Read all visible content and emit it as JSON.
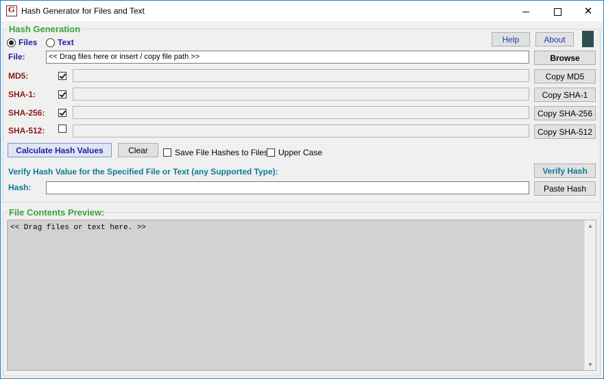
{
  "window": {
    "title": "Hash Generator for Files and Text",
    "app_icon_glyph": "G",
    "minimize": "minimize",
    "maximize": "maximize",
    "close": "✕"
  },
  "hash_generation": {
    "group_title": "Hash Generation",
    "mode": {
      "files_label": "Files",
      "text_label": "Text",
      "selected": "Files"
    },
    "help_label": "Help",
    "about_label": "About",
    "indicator_color": "#2f4f4f",
    "file": {
      "label": "File:",
      "placeholder": "<< Drag files here or insert / copy file path >>",
      "browse_label": "Browse"
    },
    "hashes": [
      {
        "label": "MD5:",
        "checked": true,
        "value": "",
        "copy_label": "Copy MD5"
      },
      {
        "label": "SHA-1:",
        "checked": true,
        "value": "",
        "copy_label": "Copy SHA-1"
      },
      {
        "label": "SHA-256:",
        "checked": true,
        "value": "",
        "copy_label": "Copy SHA-256"
      },
      {
        "label": "SHA-512:",
        "checked": false,
        "value": "",
        "copy_label": "Copy SHA-512"
      }
    ],
    "calculate_label": "Calculate Hash Values",
    "clear_label": "Clear",
    "save_hashes_label": "Save File Hashes to Files",
    "save_hashes_checked": false,
    "upper_case_label": "Upper Case",
    "upper_case_checked": false,
    "verify_title": "Verify Hash Value for the Specified File or Text (any Supported Type):",
    "verify_button_label": "Verify Hash",
    "hash_label": "Hash:",
    "hash_value": "",
    "paste_hash_label": "Paste Hash"
  },
  "preview": {
    "group_title": "File Contents Preview:",
    "placeholder": "<< Drag files or text here. >>"
  },
  "colors": {
    "group_title": "#3aa03a",
    "label_navy": "#1e1ea8",
    "label_maroon": "#8b1a1a",
    "label_teal": "#0b7a94",
    "preview_bg": "#d2d2d2"
  }
}
